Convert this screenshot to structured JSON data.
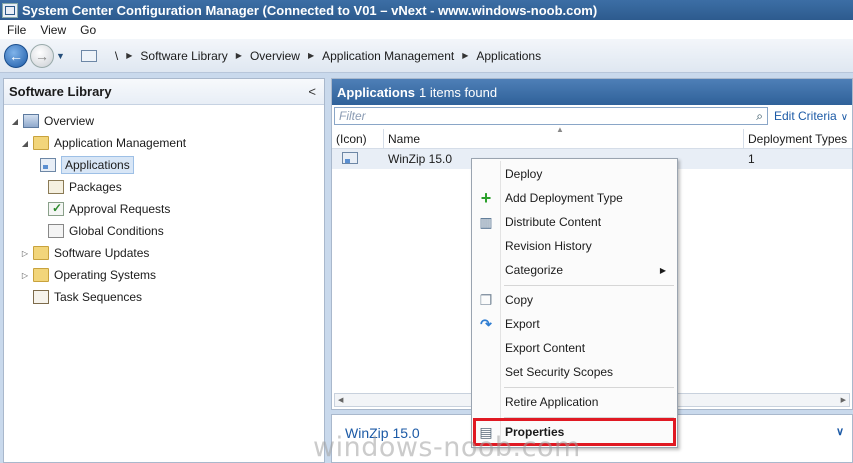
{
  "window": {
    "title": "System Center Configuration Manager (Connected to V01 – vNext - www.windows-noob.com)"
  },
  "menubar": {
    "items": [
      "File",
      "View",
      "Go"
    ]
  },
  "breadcrumb": {
    "root": "\\",
    "items": [
      "Software Library",
      "Overview",
      "Application Management",
      "Applications"
    ]
  },
  "sidebar": {
    "title": "Software Library",
    "collapse_glyph": "<",
    "tree": [
      {
        "label": "Overview",
        "icon": "overview-icon"
      },
      {
        "label": "Application Management",
        "icon": "folder-icon"
      },
      {
        "label": "Applications",
        "icon": "application-icon",
        "selected": true
      },
      {
        "label": "Packages",
        "icon": "package-icon"
      },
      {
        "label": "Approval Requests",
        "icon": "approval-icon"
      },
      {
        "label": "Global Conditions",
        "icon": "conditions-icon"
      },
      {
        "label": "Software Updates",
        "icon": "folder-icon"
      },
      {
        "label": "Operating Systems",
        "icon": "folder-icon"
      },
      {
        "label": "Task Sequences",
        "icon": "task-sequence-icon"
      }
    ]
  },
  "main": {
    "title": "Applications",
    "count_text": "1 items found",
    "filter_placeholder": "Filter",
    "edit_criteria": "Edit Criteria",
    "columns": [
      "(Icon)",
      "Name",
      "Deployment Types"
    ],
    "rows": [
      {
        "name": "WinZip 15.0",
        "deployment_types": "1"
      }
    ]
  },
  "details": {
    "title": "WinZip 15.0"
  },
  "context_menu": {
    "items": [
      "Deploy",
      "Add Deployment Type",
      "Distribute Content",
      "Revision History",
      "Categorize",
      "Copy",
      "Export",
      "Export Content",
      "Set Security Scopes",
      "Retire Application",
      "Properties"
    ]
  },
  "watermark": "windows-noob.com",
  "colors": {
    "title_bar": "#2d5b8e",
    "accent": "#1c5aa6",
    "highlight_box": "#e01923"
  }
}
